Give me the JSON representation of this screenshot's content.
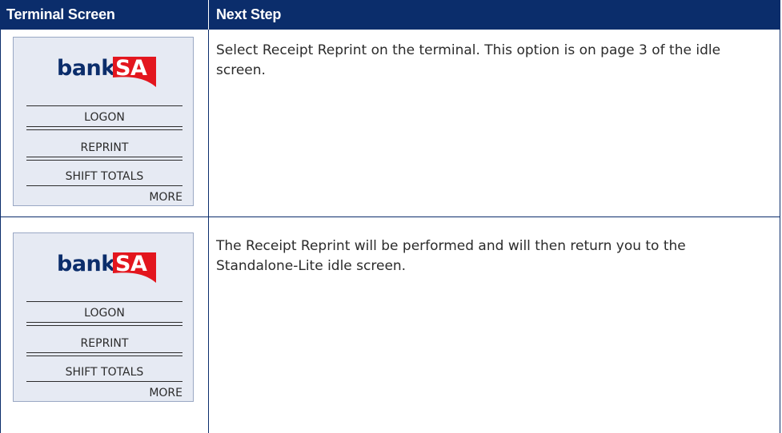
{
  "header": {
    "col1": "Terminal Screen",
    "col2": "Next Step"
  },
  "rows": [
    {
      "terminal": {
        "logo_left": "bank",
        "logo_right": "SA",
        "menu": [
          "LOGON",
          "REPRINT",
          "SHIFT TOTALS"
        ],
        "more": "MORE"
      },
      "step": "Select Receipt Reprint on the terminal. This option is on page 3 of the idle screen."
    },
    {
      "terminal": {
        "logo_left": "bank",
        "logo_right": "SA",
        "menu": [
          "LOGON",
          "REPRINT",
          "SHIFT TOTALS"
        ],
        "more": "MORE"
      },
      "step": "The Receipt Reprint will be performed and will then return you to the Standalone-Lite idle screen."
    }
  ],
  "colors": {
    "header_bg": "#0b2d6b",
    "logo_blue": "#0b2d6b",
    "logo_red": "#e3161e",
    "terminal_bg": "#e6eaf3"
  }
}
